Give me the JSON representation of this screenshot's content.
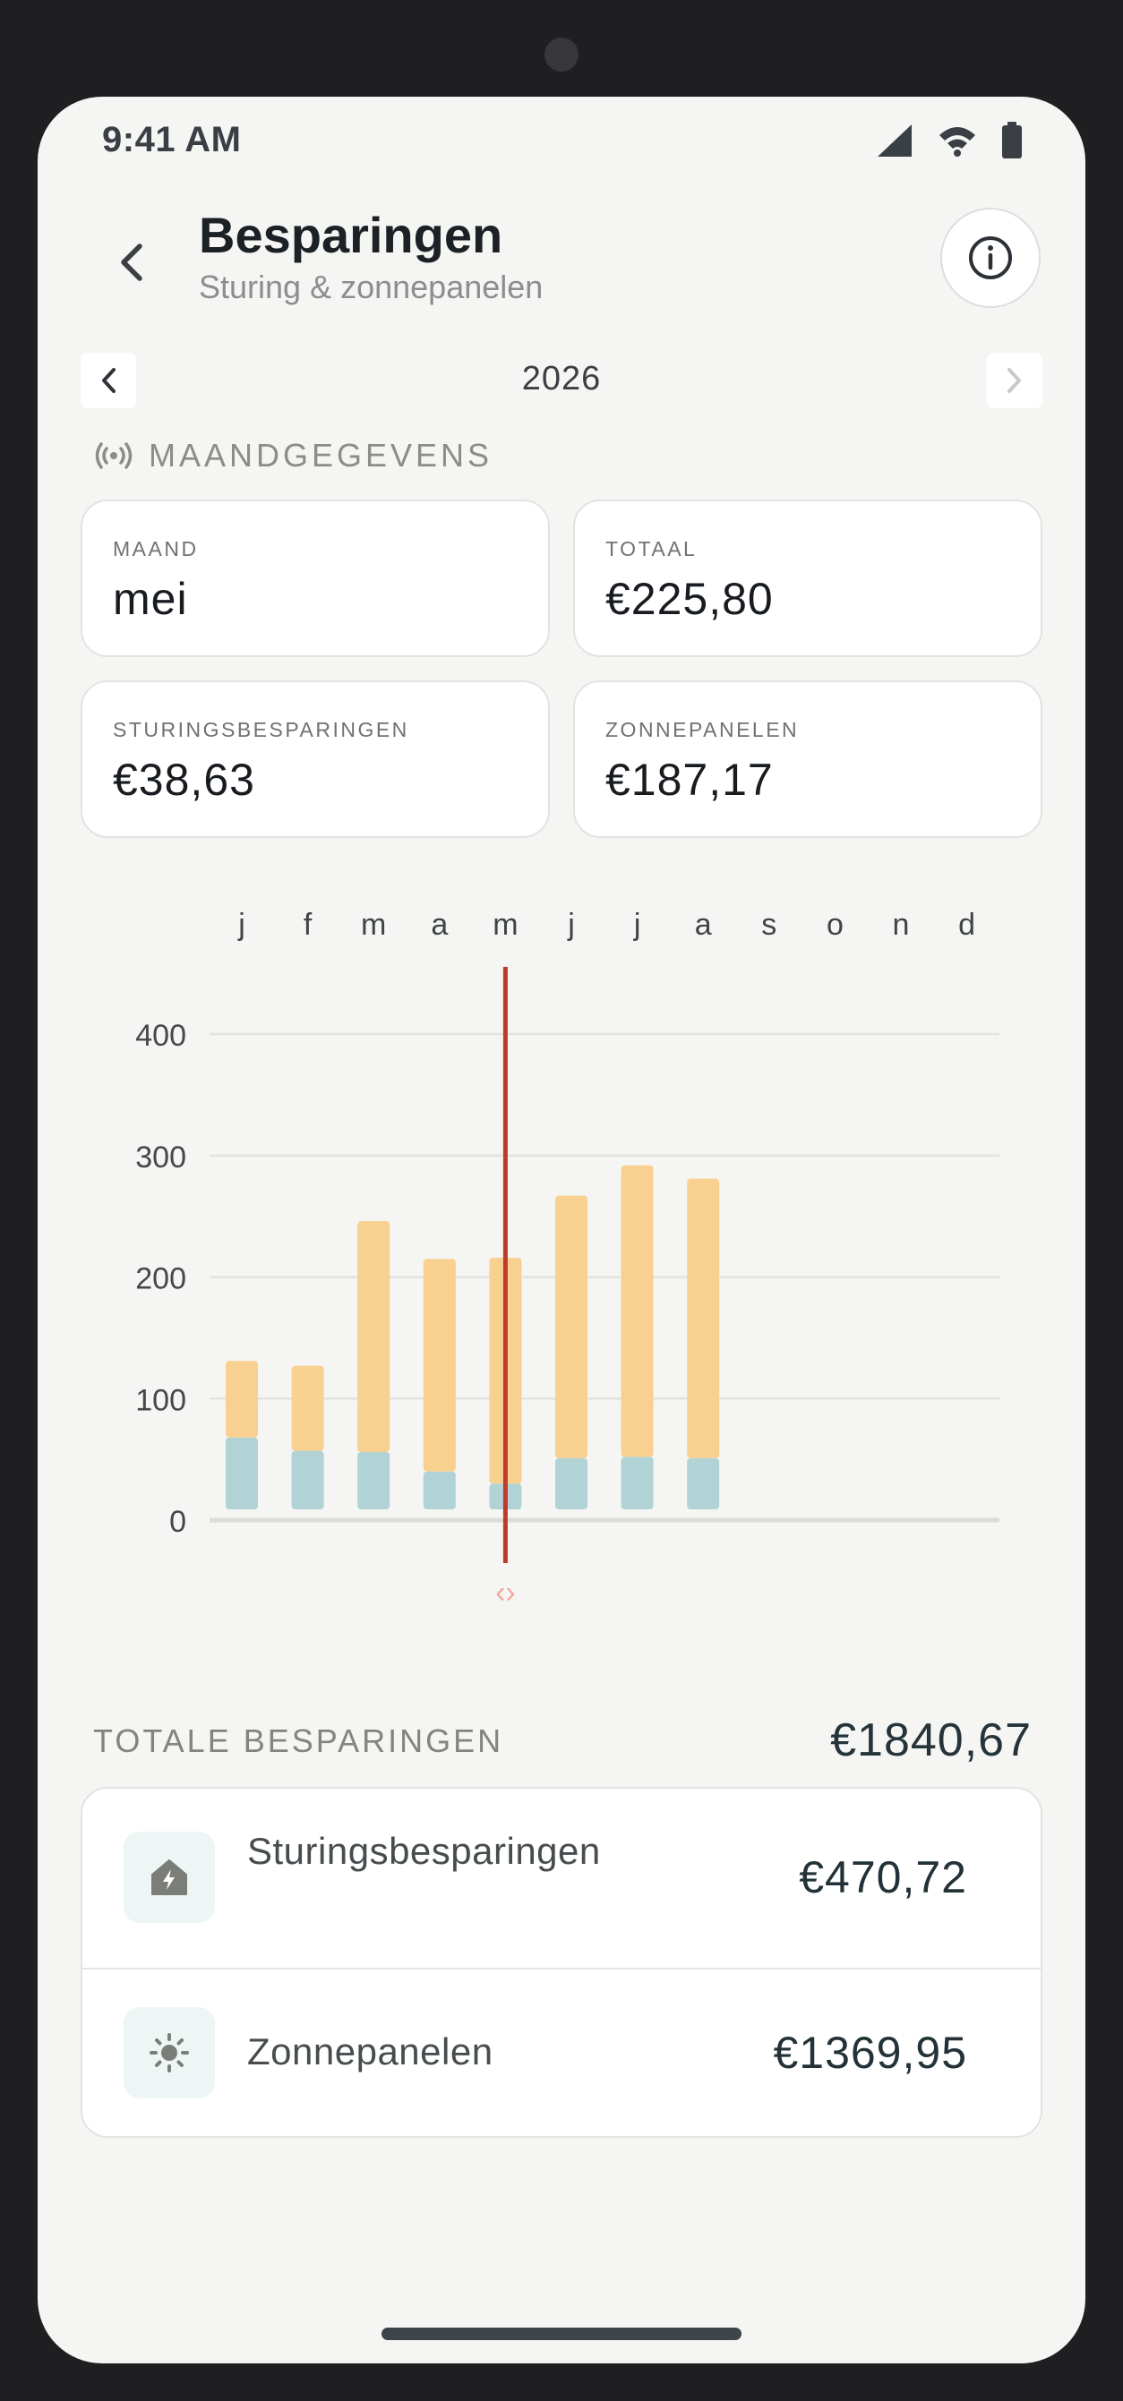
{
  "status_bar": {
    "time": "9:41 AM"
  },
  "header": {
    "title": "Besparingen",
    "subtitle": "Sturing & zonnepanelen"
  },
  "year_nav": {
    "year": "2026"
  },
  "section": {
    "label": "MAANDGEGEVENS"
  },
  "cards": {
    "month": {
      "label": "MAAND",
      "value": "mei"
    },
    "total": {
      "label": "TOTAAL",
      "value": "€225,80"
    },
    "control": {
      "label": "STURINGSBESPARINGEN",
      "value": "€38,63"
    },
    "solar": {
      "label": "ZONNEPANELEN",
      "value": "€187,17"
    }
  },
  "chart_data": {
    "type": "bar",
    "stacked": true,
    "categories": [
      "j",
      "f",
      "m",
      "a",
      "m",
      "j",
      "j",
      "a",
      "s",
      "o",
      "n",
      "d"
    ],
    "series": [
      {
        "values": [
          68,
          57,
          56,
          40,
          30,
          51,
          52,
          51,
          null,
          null,
          null,
          null
        ],
        "color": "#b1d3d6"
      },
      {
        "values": [
          63,
          70,
          190,
          175,
          186,
          216,
          240,
          230,
          null,
          null,
          null,
          null
        ],
        "color": "#f8d08f"
      }
    ],
    "yticks": [
      0,
      100,
      200,
      300,
      400
    ],
    "ylim": [
      0,
      420
    ],
    "selected_index": 4,
    "selector_color": "#c0392b",
    "grid": true
  },
  "totals": {
    "label": "TOTALE BESPARINGEN",
    "value": "€1840,67",
    "items": [
      {
        "label": "Sturingsbesparingen",
        "value": "€470,72",
        "icon": "home-lightning-icon"
      },
      {
        "label": "Zonnepanelen",
        "value": "€1369,95",
        "icon": "sun-icon"
      }
    ]
  }
}
